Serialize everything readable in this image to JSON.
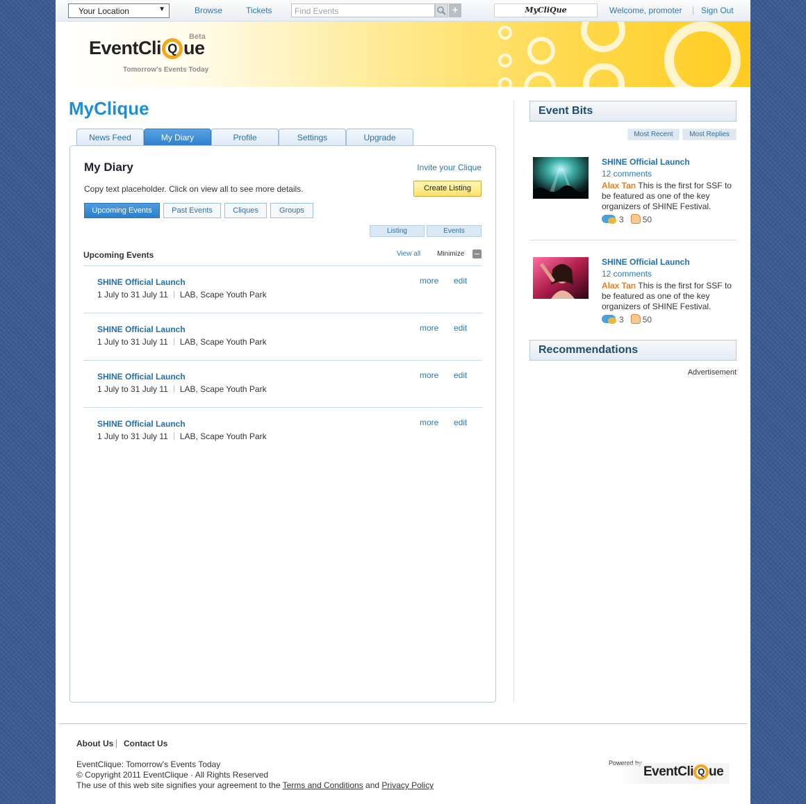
{
  "topbar": {
    "location": "Your Location",
    "browse": "Browse",
    "tickets": "Tickets",
    "search_placeholder": "Find Events",
    "plus": "+",
    "myclique_logo": "MyCliQue",
    "welcome": "Welcome, promoter",
    "signout": "Sign Out"
  },
  "banner": {
    "logo_left": "EventCli",
    "logo_q": "Q",
    "logo_right": "ue",
    "beta": "Beta",
    "tagline": "Tomorrow's Events Today",
    "colors": {
      "accent": "#f3a51b",
      "banner_end": "#ffcc20"
    }
  },
  "page_title": "MyClique",
  "tabs": [
    "News Feed",
    "My Diary",
    "Profile",
    "Settings",
    "Upgrade"
  ],
  "panel": {
    "title": "My Diary",
    "invite": "Invite your Clique",
    "copy": "Copy text placeholder. Click on view all to see more details.",
    "create": "Create Listing",
    "subtabs": [
      "Upcoming Events",
      "Past Events",
      "Cliques",
      "Groups"
    ],
    "minitabs": [
      "Listing",
      "Events"
    ],
    "section": "Upcoming Events",
    "view_all": "View all",
    "minimize": "Minimize",
    "events": [
      {
        "title": "SHINE Official Launch",
        "date": "1 July to 31 July 11",
        "venue": "LAB, Scape Youth Park",
        "more": "more",
        "edit": "edit"
      },
      {
        "title": "SHINE Official Launch",
        "date": "1 July to 31 July 11",
        "venue": "LAB, Scape Youth Park",
        "more": "more",
        "edit": "edit"
      },
      {
        "title": "SHINE Official Launch",
        "date": "1 July to 31 July 11",
        "venue": "LAB, Scape Youth Park",
        "more": "more",
        "edit": "edit"
      },
      {
        "title": "SHINE Official Launch",
        "date": "1 July to 31 July 11",
        "venue": "LAB, Scape Youth Park",
        "more": "more",
        "edit": "edit"
      }
    ]
  },
  "sidebar": {
    "event_bits": "Event Bits",
    "sort": [
      "Most Recent",
      "Most Replies"
    ],
    "bits": [
      {
        "title": "SHINE Official Launch",
        "comments": "12 comments",
        "author": "Alax Tan",
        "text": "This is the first for SSF to be featured as one of the key organizers of SHINE Festival.",
        "replies": "3",
        "likes": "50"
      },
      {
        "title": "SHINE Official Launch",
        "comments": "12 comments",
        "author": "Alax Tan",
        "text": "This is the first for SSF to be featured as one of the key organizers of SHINE Festival.",
        "replies": "3",
        "likes": "50"
      }
    ],
    "recommendations": "Recommendations",
    "advertisement": "Advertisement"
  },
  "footer": {
    "about": "About Us",
    "contact": "Contact Us",
    "line1": "EventClique: Tomorrow's Events Today",
    "line2": "© Copyright 2011 EventClique · All Rights Reserved",
    "line3_pre": "The use of this web site signifies your agreement to the",
    "terms": "Terms and Conditions",
    "line3_and": "and",
    "privacy": "Privacy Policy",
    "powered": "Powered by",
    "logo_left": "EventCli",
    "logo_q": "Q",
    "logo_right": "ue"
  }
}
